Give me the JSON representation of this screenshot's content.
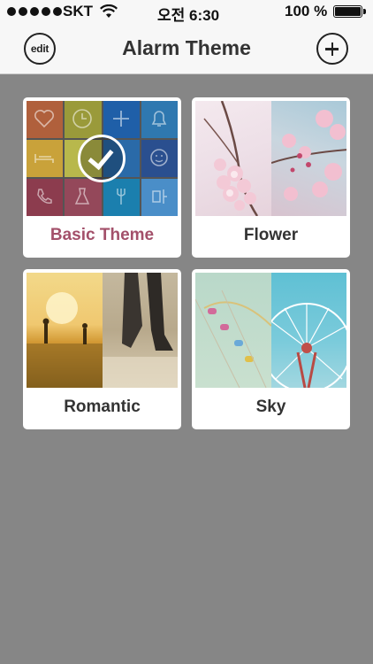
{
  "status": {
    "carrier": "SKT",
    "time": "오전 6:30",
    "battery": "100 %"
  },
  "nav": {
    "title": "Alarm Theme",
    "edit_label": "edit"
  },
  "themes": [
    {
      "label": "Basic Theme",
      "selected": true
    },
    {
      "label": "Flower",
      "selected": false
    },
    {
      "label": "Romantic",
      "selected": false
    },
    {
      "label": "Sky",
      "selected": false
    }
  ],
  "basic_grid_colors": [
    "#b0603c",
    "#9a9a3a",
    "#1f5fa8",
    "#2f78b0",
    "#c9a23a",
    "#b8b84c",
    "#2a6aa8",
    "#2a4f8f",
    "#8c3c4e",
    "#94485a",
    "#1b7fae",
    "#4a8ec8"
  ],
  "colors": {
    "selected_label": "#a3506a",
    "background": "#868686"
  }
}
